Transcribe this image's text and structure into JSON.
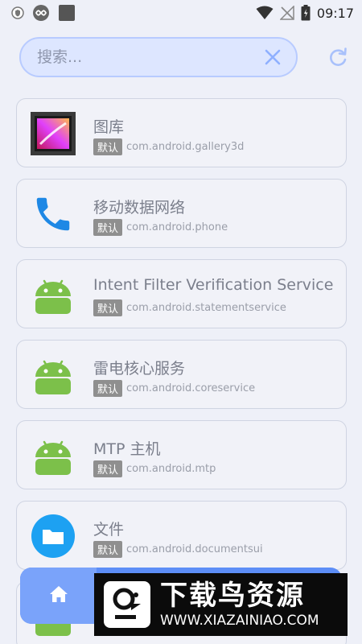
{
  "status_bar": {
    "time": "09:17",
    "left_icons": [
      "shield-icon",
      "infinity-icon",
      "square-icon"
    ],
    "right_icons": [
      "wifi-icon",
      "no-signal-icon",
      "battery-icon"
    ]
  },
  "search": {
    "placeholder": "搜索...",
    "clear_icon": "close-icon",
    "refresh_icon": "refresh-icon"
  },
  "apps": [
    {
      "name": "图库",
      "badge": "默认",
      "package": "com.android.gallery3d",
      "icon": "gallery-icon"
    },
    {
      "name": "移动数据网络",
      "badge": "默认",
      "package": "com.android.phone",
      "icon": "phone-icon"
    },
    {
      "name": "Intent Filter Verification Service",
      "badge": "默认",
      "package": "com.android.statementservice",
      "icon": "android-icon"
    },
    {
      "name": "雷电核心服务",
      "badge": "默认",
      "package": "com.android.coreservice",
      "icon": "android-icon"
    },
    {
      "name": "MTP 主机",
      "badge": "默认",
      "package": "com.android.mtp",
      "icon": "android-icon"
    },
    {
      "name": "文件",
      "badge": "默认",
      "package": "com.android.documentsui",
      "icon": "folder-icon"
    }
  ],
  "bottom_nav": {
    "home_icon": "home-icon"
  },
  "watermark": {
    "title": "下载鸟资源",
    "url": "WWW.XIAZAINIAO.COM"
  },
  "colors": {
    "accent": "#5d8ef7",
    "search_bg": "#dde6ff",
    "android_green": "#7cc04a",
    "phone_blue": "#1e88e5",
    "badge_gray": "#8f8f8f"
  }
}
